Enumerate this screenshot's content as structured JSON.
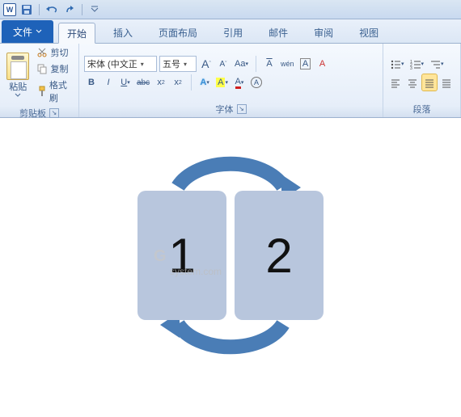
{
  "qat": {
    "word": "W"
  },
  "tabs": {
    "file": "文件",
    "items": [
      "开始",
      "插入",
      "页面布局",
      "引用",
      "邮件",
      "审阅",
      "视图"
    ],
    "activeIndex": 0
  },
  "clipboard": {
    "paste": "粘贴",
    "cut": "剪切",
    "copy": "复制",
    "formatPainter": "格式刷",
    "groupLabel": "剪贴板"
  },
  "font": {
    "name": "宋体 (中文正",
    "size": "五号",
    "growLabel": "A",
    "shrinkLabel": "A",
    "changeCase": "Aa",
    "phonetic": "A",
    "charBorderWen": "wén",
    "charShadeA": "A",
    "clearFmt": "A",
    "bold": "B",
    "italic": "I",
    "underline": "U",
    "strike": "abc",
    "sub": "x",
    "sup": "x",
    "highlightA": "A",
    "colorA": "A",
    "effectsA": "A",
    "groupLabel": "字体"
  },
  "paragraph": {
    "groupLabel": "段落"
  },
  "diagram": {
    "left": "1",
    "right": "2"
  },
  "watermark": {
    "big": "G",
    "small": "system.com"
  }
}
